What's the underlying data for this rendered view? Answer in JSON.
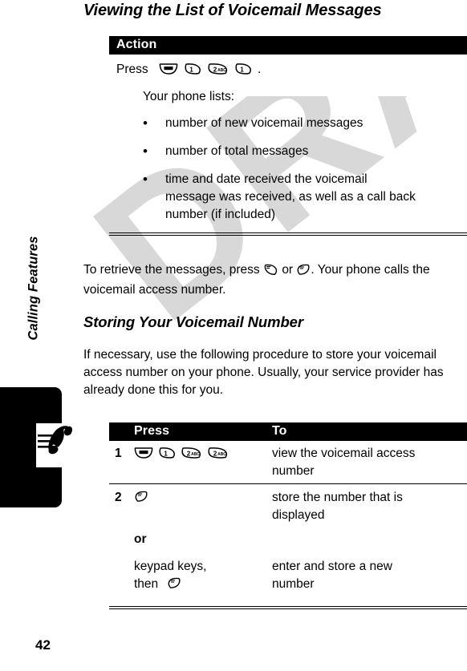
{
  "document": {
    "page_title": "Viewing the List of Voicemail Messages",
    "section_title": "Storing Your Voicemail Number",
    "page_number": "42",
    "watermark": "DRAFT"
  },
  "sidebar": {
    "chapter_label": "Calling Features",
    "tab_icon_name": "phone-handset-icon"
  },
  "action_table": {
    "header": "Action",
    "press_word": "Press",
    "period": ".",
    "keys": [
      {
        "name": "menu-key",
        "label": "MENU",
        "type": "menu"
      },
      {
        "name": "key-1",
        "label": "1",
        "type": "numeric"
      },
      {
        "name": "key-2-abc",
        "label": "2",
        "sub": "ABC",
        "type": "numeric"
      },
      {
        "name": "key-1",
        "label": "1",
        "type": "numeric"
      }
    ],
    "intro": "Your phone lists:",
    "bullets": [
      "number of new voicemail messages",
      "number of total messages",
      "time and date received the voicemail message was received, as well as a call back number (if included)"
    ]
  },
  "paragraphs": {
    "retrieve_before": "To retrieve the messages, press",
    "retrieve_mid": "or",
    "retrieve_after": ". Your phone calls the voicemail access number.",
    "necessary": "If necessary, use the following procedure to store your voicemail access number on your phone. Usually, your service provider has already done this for you."
  },
  "press_table": {
    "header_press": "Press",
    "header_to": "To",
    "rows": [
      {
        "step": "1",
        "keys": [
          {
            "name": "menu-key",
            "label": "MENU",
            "type": "menu"
          },
          {
            "name": "key-1",
            "label": "1",
            "type": "numeric"
          },
          {
            "name": "key-2-abc",
            "label": "2",
            "sub": "ABC",
            "type": "numeric"
          },
          {
            "name": "key-2-abc",
            "label": "2",
            "sub": "ABC",
            "type": "numeric"
          }
        ],
        "to": "view the voicemail access number"
      },
      {
        "step": "2",
        "keys": [
          {
            "name": "soft-key-right",
            "type": "softkey"
          }
        ],
        "to": "store the number that is displayed",
        "or_label": "or",
        "alt_press_line1": "keypad keys,",
        "alt_press_line2": "then",
        "alt_to": "enter and store a new number"
      }
    ]
  }
}
